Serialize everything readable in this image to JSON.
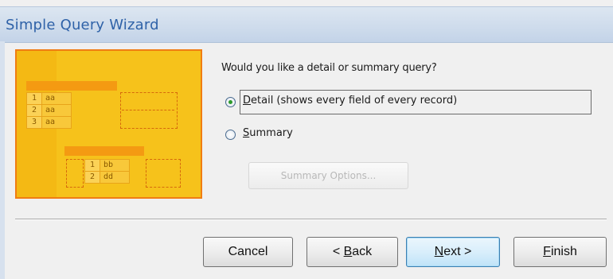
{
  "window": {
    "title": "Simple Query Wizard"
  },
  "illustration": {
    "top_table_rows": [
      {
        "num": "1",
        "val": "aa"
      },
      {
        "num": "2",
        "val": "aa"
      },
      {
        "num": "3",
        "val": "aa"
      }
    ],
    "bottom_table_rows": [
      {
        "num": "1",
        "val": "bb"
      },
      {
        "num": "2",
        "val": "dd"
      }
    ]
  },
  "main": {
    "question": "Would you like a detail or summary query?",
    "options": [
      {
        "mnemonic": "D",
        "rest": "etail (shows every field of every record)",
        "selected": true
      },
      {
        "mnemonic": "S",
        "rest": "ummary",
        "selected": false
      }
    ],
    "summary_options_label": "Summary Options..."
  },
  "buttons": {
    "cancel": {
      "label": "Cancel"
    },
    "back": {
      "prefix": "< ",
      "mnemonic": "B",
      "rest": "ack"
    },
    "next": {
      "mnemonic": "N",
      "rest": "ext >"
    },
    "finish": {
      "mnemonic": "F",
      "rest": "inish"
    }
  },
  "colors": {
    "title": "#2f62a8",
    "illustration_fill": "#f6c21b",
    "illustration_border": "#f07d12",
    "radio_selected": "#2c9a2c"
  }
}
